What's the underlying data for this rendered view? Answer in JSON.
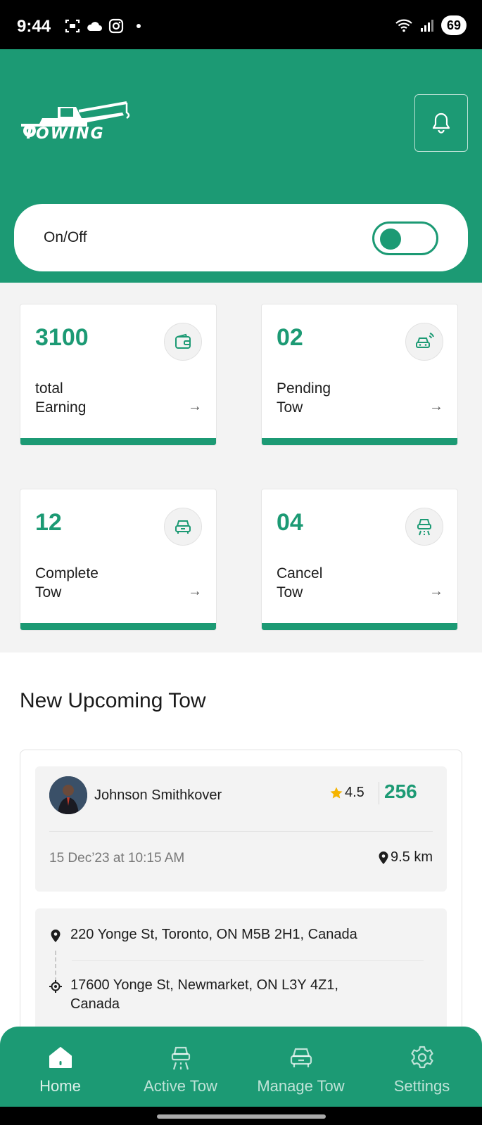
{
  "status_bar": {
    "time": "9:44",
    "battery": "69"
  },
  "header": {
    "logo_text": "TOWING",
    "toggle": {
      "label": "On/Off",
      "state": "off"
    }
  },
  "stats": [
    {
      "value": "3100",
      "label_line1": "total",
      "label_line2": "Earning",
      "icon": "wallet-icon"
    },
    {
      "value": "02",
      "label_line1": "Pending",
      "label_line2": "Tow",
      "icon": "car-signal-icon"
    },
    {
      "value": "12",
      "label_line1": "Complete",
      "label_line2": "Tow",
      "icon": "car-icon"
    },
    {
      "value": "04",
      "label_line1": "Cancel",
      "label_line2": "Tow",
      "icon": "car-road-icon"
    }
  ],
  "upcoming": {
    "title": "New Upcoming Tow",
    "customer_name": "Johnson Smithkover",
    "rating": "4.5",
    "amount": "256",
    "date": "15 Dec’23 at 10:15 AM",
    "distance": "9.5 km",
    "pickup": "220 Yonge St, Toronto, ON M5B 2H1, Canada",
    "dropoff_line1": "17600 Yonge St, Newmarket, ON L3Y 4Z1,",
    "dropoff_line2": "Canada"
  },
  "bottom_nav": [
    {
      "label": "Home",
      "icon": "home-icon",
      "active": true
    },
    {
      "label": "Active Tow",
      "icon": "car-road-icon",
      "active": false
    },
    {
      "label": "Manage Tow",
      "icon": "car-icon",
      "active": false
    },
    {
      "label": "Settings",
      "icon": "gear-icon",
      "active": false
    }
  ],
  "colors": {
    "brand": "#1c9a74",
    "star": "#f5b400"
  }
}
